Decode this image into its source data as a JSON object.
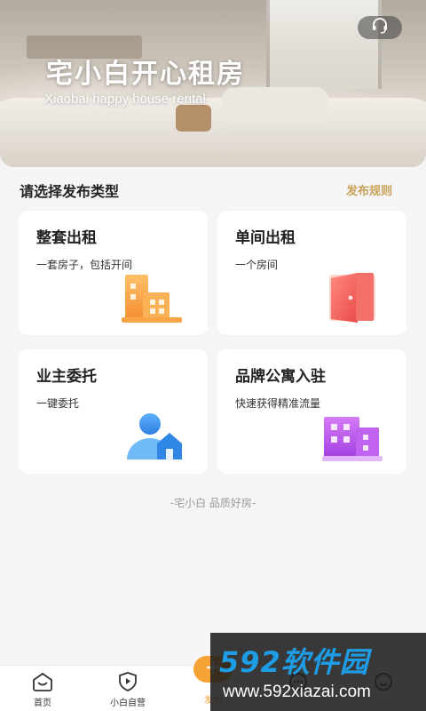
{
  "hero": {
    "title": "宅小白开心租房",
    "subtitle": "Xiaobai happy house rental",
    "service_icon": "headset-icon"
  },
  "section": {
    "title": "请选择发布类型",
    "rules_link": "发布规则",
    "accent_color": "#c9a35b"
  },
  "cards": [
    {
      "title": "整套出租",
      "desc": "一套房子，包括开间",
      "icon": "building-icon",
      "color": "#f7a54a"
    },
    {
      "title": "单间出租",
      "desc": "一个房间",
      "icon": "door-icon",
      "color": "#f0625f"
    },
    {
      "title": "业主委托",
      "desc": "一键委托",
      "icon": "owner-house-icon",
      "color": "#3a8ee8"
    },
    {
      "title": "品牌公寓入驻",
      "desc": "快速获得精准流量",
      "icon": "apartment-icon",
      "color": "#b25ee8"
    }
  ],
  "footer_slogan": "-宅小白 品质好房-",
  "tabbar": {
    "items": [
      {
        "label": "首页",
        "icon": "home-icon"
      },
      {
        "label": "小白自营",
        "icon": "shield-play-icon"
      },
      {
        "label": "发布",
        "icon": "plus-icon"
      },
      {
        "label": "",
        "icon": "message-icon"
      },
      {
        "label": "",
        "icon": "smile-icon"
      }
    ],
    "publish_color": "#f5a236"
  },
  "watermark": {
    "logo": "592软件园",
    "url": "www.592xiazai.com"
  }
}
